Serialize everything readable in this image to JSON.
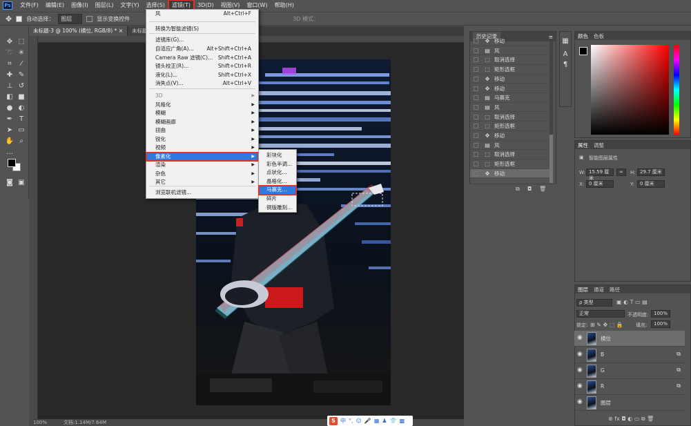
{
  "menubar": {
    "logo": "Ps",
    "items": [
      "文件(F)",
      "编辑(E)",
      "图像(I)",
      "图层(L)",
      "文字(Y)",
      "选择(S)",
      "滤镜(T)",
      "3D(D)",
      "视图(V)",
      "窗口(W)",
      "帮助(H)"
    ]
  },
  "options": {
    "auto_select": "自动选择：",
    "target": "图层",
    "show_transform": "显示变换控件",
    "mode3d": "3D 模式："
  },
  "tabs": [
    "未标题-3 @ 100% (横位, RGB/8) *",
    "未标题-4"
  ],
  "filter_menu": {
    "items": [
      {
        "label": "风",
        "shortcut": "Alt+Ctrl+F"
      },
      {
        "label": "转换为智能滤镜(S)",
        "shortcut": ""
      },
      {
        "label": "滤镜库(G)...",
        "shortcut": ""
      },
      {
        "label": "自适应广角(A)...",
        "shortcut": "Alt+Shift+Ctrl+A"
      },
      {
        "label": "Camera Raw 滤镜(C)...",
        "shortcut": "Shift+Ctrl+A"
      },
      {
        "label": "镜头校正(R)...",
        "shortcut": "Shift+Ctrl+R"
      },
      {
        "label": "液化(L)...",
        "shortcut": "Shift+Ctrl+X"
      },
      {
        "label": "消失点(V)...",
        "shortcut": "Alt+Ctrl+V"
      },
      {
        "label": "3D",
        "shortcut": ""
      },
      {
        "label": "风格化",
        "shortcut": ""
      },
      {
        "label": "模糊",
        "shortcut": ""
      },
      {
        "label": "模糊画廊",
        "shortcut": ""
      },
      {
        "label": "扭曲",
        "shortcut": ""
      },
      {
        "label": "锐化",
        "shortcut": ""
      },
      {
        "label": "视频",
        "shortcut": ""
      },
      {
        "label": "像素化",
        "shortcut": ""
      },
      {
        "label": "渲染",
        "shortcut": ""
      },
      {
        "label": "杂色",
        "shortcut": ""
      },
      {
        "label": "其它",
        "shortcut": ""
      },
      {
        "label": "浏览联机滤镜...",
        "shortcut": ""
      }
    ]
  },
  "pixelate_submenu": [
    "彩块化",
    "彩色半调...",
    "点状化...",
    "晶格化...",
    "马赛克...",
    "碎片",
    "铜版雕刻..."
  ],
  "history": {
    "title": "历史记录",
    "rows": [
      "移动",
      "风",
      "取消选择",
      "矩形选框",
      "移动",
      "移动",
      "马赛克",
      "风",
      "取消选择",
      "矩形选框",
      "移动",
      "风",
      "取消选择",
      "矩形选框",
      "移动"
    ]
  },
  "color_panel": {
    "tabs": [
      "颜色",
      "色板"
    ]
  },
  "properties": {
    "tabs": [
      "属性",
      "调整"
    ],
    "subtitle": "智能图层属性",
    "w_label": "W:",
    "w_value": "15.59 厘米",
    "h_label": "H:",
    "h_value": "29.7 厘米",
    "x_label": "X:",
    "x_value": "0 厘米",
    "y_label": "Y:",
    "y_value": "0 厘米"
  },
  "layers": {
    "tabs": [
      "图层",
      "通道",
      "路径"
    ],
    "filter": "ρ 类型",
    "blend": "正常",
    "opacity_label": "不透明度:",
    "opacity": "100%",
    "lock_label": "锁定:",
    "fill_label": "填充:",
    "fill": "100%",
    "rows": [
      "横位",
      "B",
      "G",
      "R",
      "图层"
    ]
  },
  "status": {
    "zoom": "100%",
    "doc": "文档:1.14M/7.64M"
  },
  "ime": {
    "label": "中"
  },
  "colors": {
    "accent_red": "#e0312c",
    "highlight": "#2f7ae0"
  }
}
